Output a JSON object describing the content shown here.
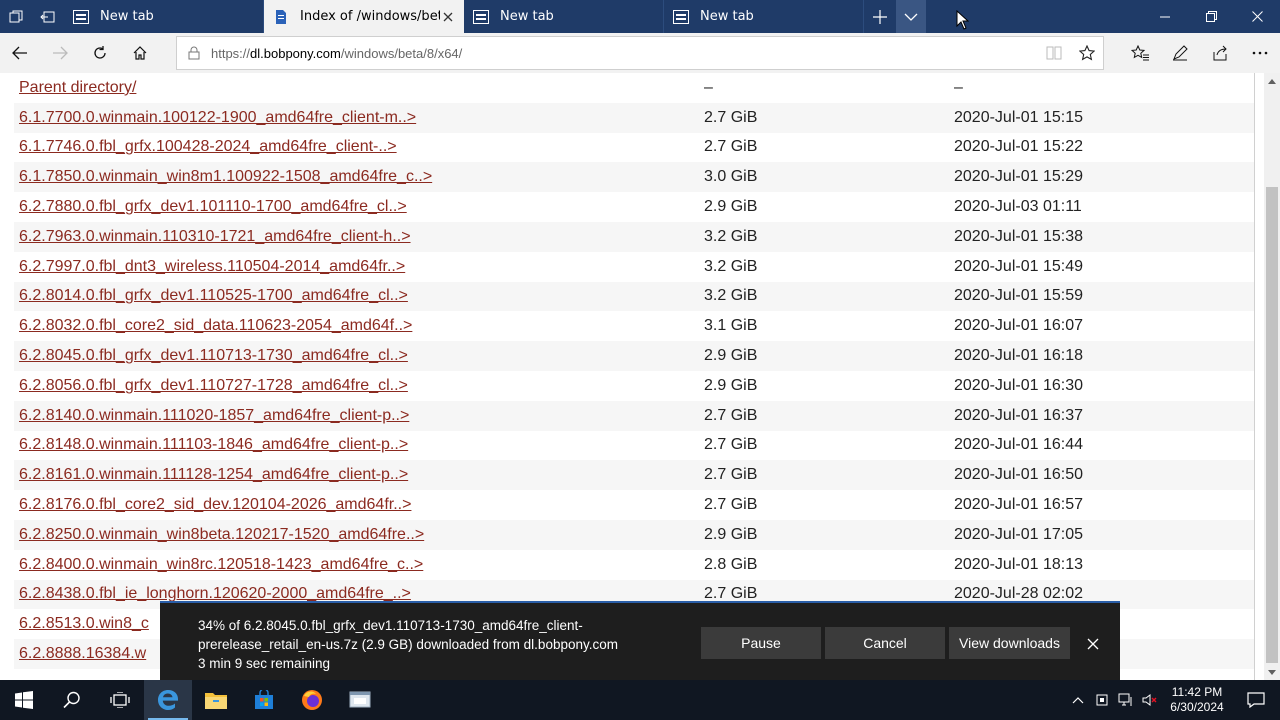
{
  "tabs": [
    {
      "title": "New tab",
      "active": false
    },
    {
      "title": "Index of /windows/beta",
      "active": true
    },
    {
      "title": "New tab",
      "active": false
    },
    {
      "title": "New tab",
      "active": false
    }
  ],
  "address": {
    "prefix": "https://",
    "host": "dl.bobpony.com",
    "path": "/windows/beta/8/x64/"
  },
  "listing": {
    "parent": {
      "name": "Parent directory/",
      "size": "–",
      "date": "–"
    },
    "rows": [
      {
        "name": "6.1.7700.0.winmain.100122-1900_amd64fre_client-m..>",
        "size": "2.7 GiB",
        "date": "2020-Jul-01 15:15"
      },
      {
        "name": "6.1.7746.0.fbl_grfx.100428-2024_amd64fre_client-..>",
        "size": "2.7 GiB",
        "date": "2020-Jul-01 15:22"
      },
      {
        "name": "6.1.7850.0.winmain_win8m1.100922-1508_amd64fre_c..>",
        "size": "3.0 GiB",
        "date": "2020-Jul-01 15:29"
      },
      {
        "name": "6.2.7880.0.fbl_grfx_dev1.101110-1700_amd64fre_cl..>",
        "size": "2.9 GiB",
        "date": "2020-Jul-03 01:11"
      },
      {
        "name": "6.2.7963.0.winmain.110310-1721_amd64fre_client-h..>",
        "size": "3.2 GiB",
        "date": "2020-Jul-01 15:38"
      },
      {
        "name": "6.2.7997.0.fbl_dnt3_wireless.110504-2014_amd64fr..>",
        "size": "3.2 GiB",
        "date": "2020-Jul-01 15:49"
      },
      {
        "name": "6.2.8014.0.fbl_grfx_dev1.110525-1700_amd64fre_cl..>",
        "size": "3.2 GiB",
        "date": "2020-Jul-01 15:59"
      },
      {
        "name": "6.2.8032.0.fbl_core2_sid_data.110623-2054_amd64f..>",
        "size": "3.1 GiB",
        "date": "2020-Jul-01 16:07"
      },
      {
        "name": "6.2.8045.0.fbl_grfx_dev1.110713-1730_amd64fre_cl..>",
        "size": "2.9 GiB",
        "date": "2020-Jul-01 16:18"
      },
      {
        "name": "6.2.8056.0.fbl_grfx_dev1.110727-1728_amd64fre_cl..>",
        "size": "2.9 GiB",
        "date": "2020-Jul-01 16:30"
      },
      {
        "name": "6.2.8140.0.winmain.111020-1857_amd64fre_client-p..>",
        "size": "2.7 GiB",
        "date": "2020-Jul-01 16:37"
      },
      {
        "name": "6.2.8148.0.winmain.111103-1846_amd64fre_client-p..>",
        "size": "2.7 GiB",
        "date": "2020-Jul-01 16:44"
      },
      {
        "name": "6.2.8161.0.winmain.111128-1254_amd64fre_client-p..>",
        "size": "2.7 GiB",
        "date": "2020-Jul-01 16:50"
      },
      {
        "name": "6.2.8176.0.fbl_core2_sid_dev.120104-2026_amd64fr..>",
        "size": "2.7 GiB",
        "date": "2020-Jul-01 16:57"
      },
      {
        "name": "6.2.8250.0.winmain_win8beta.120217-1520_amd64fre..>",
        "size": "2.9 GiB",
        "date": "2020-Jul-01 17:05"
      },
      {
        "name": "6.2.8400.0.winmain_win8rc.120518-1423_amd64fre_c..>",
        "size": "2.8 GiB",
        "date": "2020-Jul-01 18:13"
      },
      {
        "name": "6.2.8438.0.fbl_ie_longhorn.120620-2000_amd64fre_..>",
        "size": "2.7 GiB",
        "date": "2020-Jul-28 02:02"
      },
      {
        "name": "6.2.8513.0.win8_c",
        "size": "",
        "date": ""
      },
      {
        "name": "6.2.8888.16384.w",
        "size": "",
        "date": ""
      }
    ]
  },
  "download": {
    "line1": "34% of 6.2.8045.0.fbl_grfx_dev1.110713-1730_amd64fre_client-",
    "line2": "prerelease_retail_en-us.7z (2.9 GB) downloaded from dl.bobpony.com",
    "line3": "3 min 9 sec remaining",
    "progress_percent": 34,
    "pause_label": "Pause",
    "cancel_label": "Cancel",
    "view_label": "View downloads"
  },
  "clock": {
    "time": "11:42 PM",
    "date": "6/30/2024"
  },
  "colors": {
    "tabbar": "#1f3b68",
    "link": "#8b2a20",
    "taskbar": "#101722",
    "download_bar": "#1e1e1e"
  }
}
